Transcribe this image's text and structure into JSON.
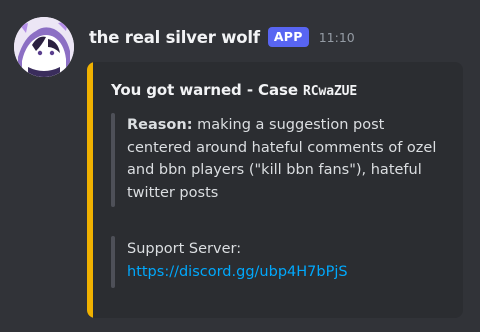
{
  "message": {
    "author": "the real silver wolf",
    "badge": "APP",
    "timestamp": "11:10",
    "avatar_icon": "anime-avatar-icon"
  },
  "embed": {
    "accent_color": "#f0b100",
    "title_prefix": "You got warned - Case",
    "case_code": "RCwaZUE",
    "reason_label": "Reason:",
    "reason_text": "making a suggestion post centered around hateful comments of ozel and bbn players (\"kill bbn fans\"), hateful twitter posts",
    "support_label": "Support Server:",
    "support_link": "https://discord.gg/ubp4H7bPjS"
  },
  "colors": {
    "background": "#313338",
    "embed_background": "#2b2d31",
    "badge": "#5865f2",
    "link": "#00a8fc"
  }
}
